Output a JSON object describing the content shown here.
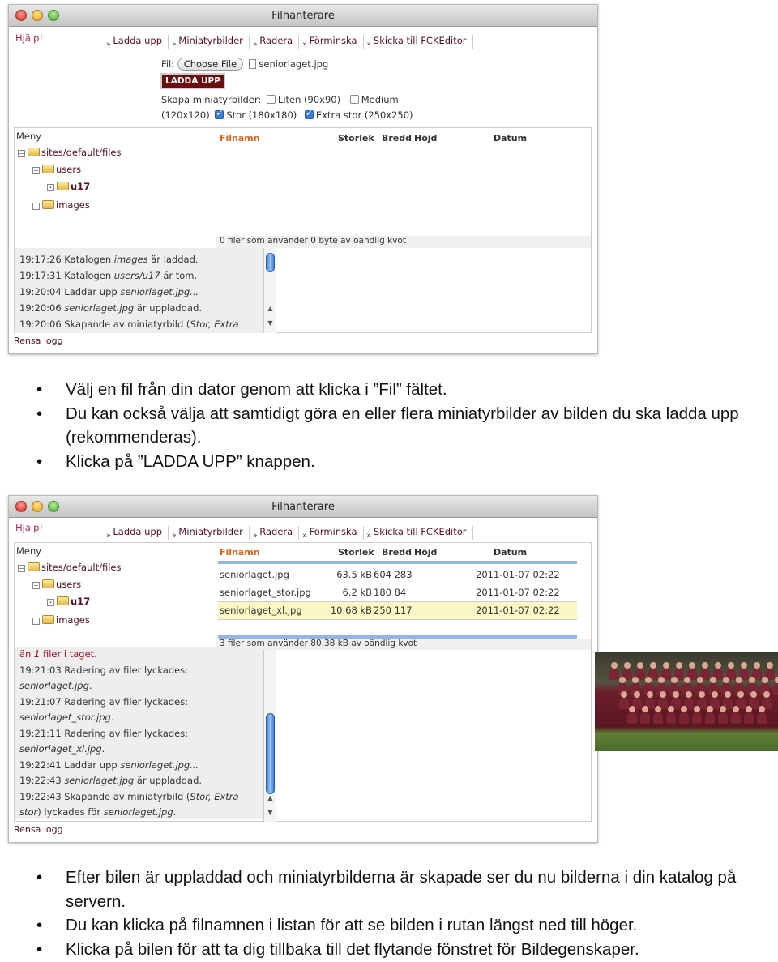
{
  "window1": {
    "title": "Filhanterare",
    "help": "Hjälp!",
    "toolbar": [
      "Ladda upp",
      "Miniatyrbilder",
      "Radera",
      "Förminska",
      "Skicka till FCKEditor"
    ],
    "file_label": "Fil:",
    "choose_file": "Choose File",
    "file_name": "seniorlaget.jpg",
    "upload_button": "LADDA UPP",
    "thumbs_label": "Skapa miniatyrbilder:",
    "thumb_options": [
      {
        "label": "Liten (90x90)",
        "checked": false
      },
      {
        "label": "Medium",
        "checked": false
      },
      {
        "label": "Stor (180x180)",
        "checked": true
      },
      {
        "label": "Extra stor (250x250)",
        "checked": true
      }
    ],
    "thumb_medium_size": "(120x120)",
    "tree": {
      "title": "Meny",
      "root": "sites/default/files",
      "users": "users",
      "u17": "u17",
      "images": "images"
    },
    "columns": [
      "Filnamn",
      "Storlek",
      "Bredd",
      "Höjd",
      "Datum"
    ],
    "status": "0 filer som använder 0 byte av oändlig kvot",
    "log": [
      [
        {
          "t": "19:17:26 Katalogen "
        },
        {
          "t": "images",
          "i": true
        },
        {
          "t": " är laddad."
        }
      ],
      [
        {
          "t": "19:17:31 Katalogen "
        },
        {
          "t": "users/u17",
          "i": true
        },
        {
          "t": " är tom."
        }
      ],
      [
        {
          "t": "19:20:04 Laddar upp "
        },
        {
          "t": "seniorlaget.jpg...",
          "i": true
        }
      ],
      [
        {
          "t": "19:20:06 "
        },
        {
          "t": "seniorlaget.jpg",
          "i": true
        },
        {
          "t": " är uppladdad."
        }
      ],
      [
        {
          "t": "19:20:06 Skapande av miniatyrbild ("
        },
        {
          "t": "Stor, Extra",
          "i": true
        }
      ]
    ],
    "clear_log": "Rensa logg"
  },
  "bullets1": [
    "Välj en fil från din dator genom att klicka i ”Fil” fältet.",
    "Du kan också välja att samtidigt göra en eller flera miniatyrbilder av bilden du ska ladda upp (rekommenderas).",
    "Klicka på ”LADDA UPP” knappen."
  ],
  "window2": {
    "title": "Filhanterare",
    "help": "Hjälp!",
    "toolbar": [
      "Ladda upp",
      "Miniatyrbilder",
      "Radera",
      "Förminska",
      "Skicka till FCKEditor"
    ],
    "tree": {
      "title": "Meny",
      "root": "sites/default/files",
      "users": "users",
      "u17": "u17",
      "images": "images"
    },
    "columns": [
      "Filnamn",
      "Storlek",
      "Bredd",
      "Höjd",
      "Datum"
    ],
    "files": [
      {
        "name": "seniorlaget.jpg",
        "size": "63.5 kB",
        "dims": "604 283",
        "date": "2011-01-07 02:22",
        "selected": false
      },
      {
        "name": "seniorlaget_stor.jpg",
        "size": "6.2 kB",
        "dims": "180 84",
        "date": "2011-01-07 02:22",
        "selected": false
      },
      {
        "name": "seniorlaget_xl.jpg",
        "size": "10.68 kB",
        "dims": "250 117",
        "date": "2011-01-07 02:22",
        "selected": true
      }
    ],
    "status": "3 filer som använder 80.38 kB av oändlig kvot",
    "log": [
      [
        {
          "t": "än ",
          "r": true
        },
        {
          "t": "1",
          "i": true,
          "r": true
        },
        {
          "t": " filer i taget.",
          "r": true
        }
      ],
      [
        {
          "t": "19:21:03 Radering av filer lyckades:"
        }
      ],
      [
        {
          "t": "seniorlaget.jpg",
          "i": true
        },
        {
          "t": "."
        }
      ],
      [
        {
          "t": "19:21:07 Radering av filer lyckades:"
        }
      ],
      [
        {
          "t": "seniorlaget_stor.jpg",
          "i": true
        },
        {
          "t": "."
        }
      ],
      [
        {
          "t": "19:21:11 Radering av filer lyckades:"
        }
      ],
      [
        {
          "t": "seniorlaget_xl.jpg",
          "i": true
        },
        {
          "t": "."
        }
      ],
      [
        {
          "t": "19:22:41 Laddar upp "
        },
        {
          "t": "seniorlaget.jpg...",
          "i": true
        }
      ],
      [
        {
          "t": "19:22:43 "
        },
        {
          "t": "seniorlaget.jpg",
          "i": true
        },
        {
          "t": " är uppladdad."
        }
      ],
      [
        {
          "t": "19:22:43 Skapande av miniatyrbild ("
        },
        {
          "t": "Stor, Extra",
          "i": true
        }
      ],
      [
        {
          "t": "stor",
          "i": true
        },
        {
          "t": ") lyckades för "
        },
        {
          "t": "seniorlaget.jpg",
          "i": true
        },
        {
          "t": "."
        }
      ]
    ],
    "clear_log": "Rensa logg"
  },
  "bullets2": [
    "Efter bilen är uppladdad och miniatyrbilderna är skapade ser du nu bilderna i din katalog på servern.",
    "Du kan klicka på filnamnen i listan för att se bilden i rutan längst ned till höger.",
    "Klicka på bilen för att ta dig tillbaka till det flytande fönstret för Bildegenskaper."
  ],
  "colors": {
    "accent": "#6a0d0d",
    "link": "#5a0f18",
    "header_highlight": "#e0621a",
    "selected_row": "#fbf7c4"
  }
}
